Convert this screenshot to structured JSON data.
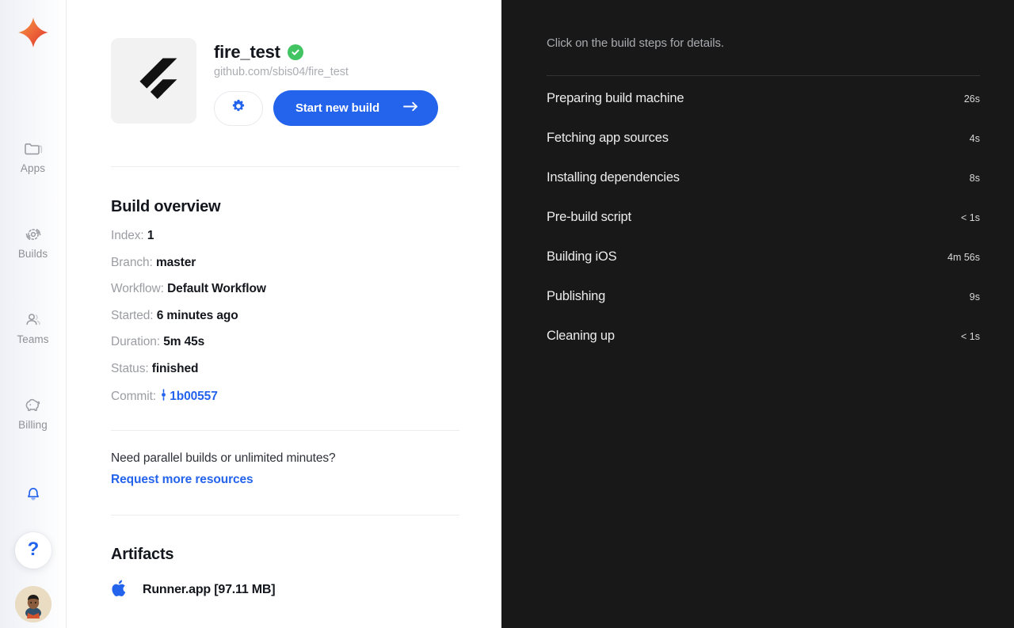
{
  "sidebar": {
    "logo_name": "codemagic-logo",
    "items": [
      {
        "label": "Apps",
        "icon": "folder-icon"
      },
      {
        "label": "Builds",
        "icon": "build-refresh-icon"
      },
      {
        "label": "Teams",
        "icon": "people-icon"
      },
      {
        "label": "Billing",
        "icon": "piggy-bank-icon"
      }
    ],
    "notifications_icon": "bell-icon",
    "help_label": "?",
    "avatar_name": "user-avatar"
  },
  "app_header": {
    "platform_icon": "flutter-logo",
    "title": "fire_test",
    "status_icon": "green-check-badge",
    "repo_url": "github.com/sbis04/fire_test",
    "settings_icon": "gear-icon",
    "start_build_label": "Start new build",
    "start_build_arrow": "arrow-right-icon"
  },
  "build_overview": {
    "heading": "Build overview",
    "rows": [
      {
        "label": "Index:",
        "value": "1"
      },
      {
        "label": "Branch:",
        "value": "master"
      },
      {
        "label": "Workflow:",
        "value": "Default Workflow"
      },
      {
        "label": "Started:",
        "value": "6 minutes ago"
      },
      {
        "label": "Duration:",
        "value": "5m 45s"
      },
      {
        "label": "Status:",
        "value": "finished"
      }
    ],
    "commit_label": "Commit:",
    "commit_hash": "1b00557",
    "commit_icon": "git-commit-icon"
  },
  "promo": {
    "text": "Need parallel builds or unlimited minutes?",
    "link_label": "Request more resources"
  },
  "artifacts": {
    "heading": "Artifacts",
    "items": [
      {
        "icon": "apple-icon",
        "name": "Runner.app [97.11 MB]"
      }
    ]
  },
  "steps_panel": {
    "hint": "Click on the build steps for details.",
    "steps": [
      {
        "name": "Preparing build machine",
        "duration": "26s"
      },
      {
        "name": "Fetching app sources",
        "duration": "4s"
      },
      {
        "name": "Installing dependencies",
        "duration": "8s"
      },
      {
        "name": "Pre-build script",
        "duration": "< 1s"
      },
      {
        "name": "Building iOS",
        "duration": "4m 56s"
      },
      {
        "name": "Publishing",
        "duration": "9s"
      },
      {
        "name": "Cleaning up",
        "duration": "< 1s"
      }
    ]
  },
  "colors": {
    "accent_blue": "#2463eb",
    "status_green": "#43c463",
    "dark_panel": "#181818",
    "logo_orange": "#f08a3c",
    "logo_red": "#e0392f"
  }
}
